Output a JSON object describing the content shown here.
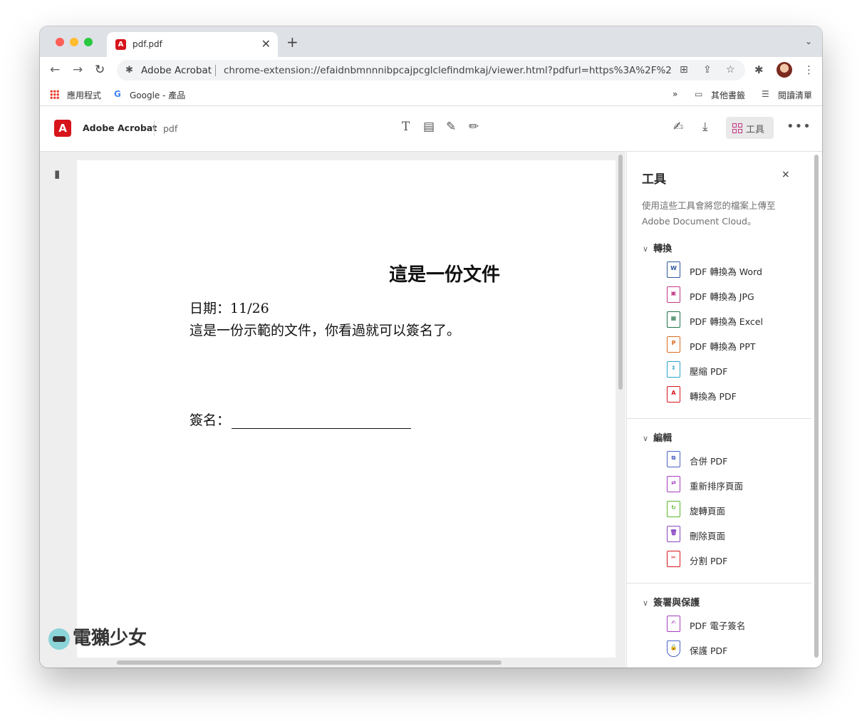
{
  "browser": {
    "tab_title": "pdf.pdf",
    "tab_close": "✕",
    "new_tab": "+",
    "origin": "Adobe Acrobat",
    "url": "chrome-extension://efaidnbmnnnibpcajpcglclefindmkaj/viewer.html?pdfurl=https%3A%2F%2...",
    "bookmarks": {
      "apps": "應用程式",
      "google_logo": "G",
      "google": "Google - 產品",
      "overflow": "»",
      "other": "其他書籤",
      "reading_list": "閱讀清單"
    }
  },
  "acrobat": {
    "brand": "Adobe Acrobat",
    "file_name": "pdf",
    "tools_label": "工具",
    "more": "•••"
  },
  "document": {
    "title": "這是一份文件",
    "date_line": "日期：11/26",
    "body_line": "這是一份示範的文件，你看過就可以簽名了。",
    "sign_label": "簽名："
  },
  "watermark": "電獺少女",
  "panel": {
    "title": "工具",
    "close": "×",
    "desc_line1": "使用這些工具會將您的檔案上傳至",
    "desc_line2": "Adobe Document Cloud。",
    "groups": [
      {
        "title": "轉換",
        "items": [
          {
            "label": "PDF 轉換為 Word",
            "icon": "pdf-to-word-icon",
            "color": "#2b579a"
          },
          {
            "label": "PDF 轉換為 JPG",
            "icon": "pdf-to-jpg-icon",
            "color": "#c13584"
          },
          {
            "label": "PDF 轉換為 Excel",
            "icon": "pdf-to-excel-icon",
            "color": "#217346"
          },
          {
            "label": "PDF 轉換為 PPT",
            "icon": "pdf-to-ppt-icon",
            "color": "#d86a1f"
          },
          {
            "label": "壓縮 PDF",
            "icon": "compress-pdf-icon",
            "color": "#2aa5c8"
          },
          {
            "label": "轉換為 PDF",
            "icon": "convert-to-pdf-icon",
            "color": "#d7141b"
          }
        ]
      },
      {
        "title": "編輯",
        "items": [
          {
            "label": "合併 PDF",
            "icon": "merge-pdf-icon",
            "color": "#4a63c4"
          },
          {
            "label": "重新排序頁面",
            "icon": "reorder-pages-icon",
            "color": "#a63cbf"
          },
          {
            "label": "旋轉頁面",
            "icon": "rotate-pages-icon",
            "color": "#5ab52a"
          },
          {
            "label": "刪除頁面",
            "icon": "delete-pages-icon",
            "color": "#8a45c0"
          },
          {
            "label": "分割 PDF",
            "icon": "split-pdf-icon",
            "color": "#d7141b"
          }
        ]
      },
      {
        "title": "簽署與保護",
        "items": [
          {
            "label": "PDF 電子簽名",
            "icon": "esign-pdf-icon",
            "color": "#a63cbf"
          },
          {
            "label": "保護 PDF",
            "icon": "protect-pdf-icon",
            "color": "#4a63c4"
          }
        ]
      }
    ]
  }
}
